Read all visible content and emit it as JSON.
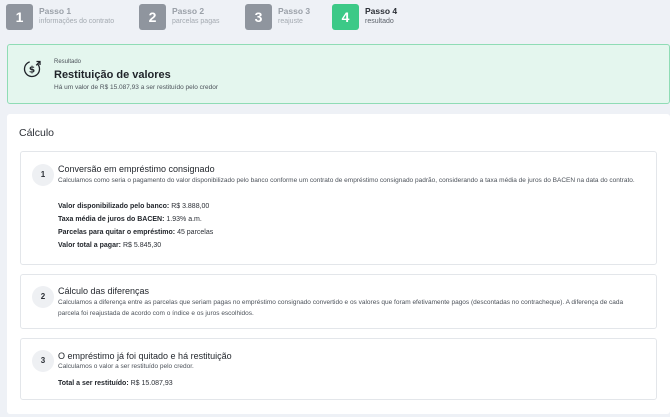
{
  "stepper": {
    "steps": [
      {
        "number": "1",
        "title": "Passo 1",
        "subtitle": "informações do contrato"
      },
      {
        "number": "2",
        "title": "Passo 2",
        "subtitle": "parcelas pagas"
      },
      {
        "number": "3",
        "title": "Passo 3",
        "subtitle": "reajuste"
      },
      {
        "number": "4",
        "title": "Passo 4",
        "subtitle": "resultado"
      }
    ],
    "active_step": 4
  },
  "result": {
    "label": "Resultado",
    "title": "Restituição de valores",
    "message": "Há um valor de R$ 15.087,93 a ser restituído pelo credor",
    "icon": "dollar-refund-icon"
  },
  "calculation": {
    "title": "Cálculo",
    "cards": [
      {
        "number": "1",
        "title": "Conversão em empréstimo consignado",
        "text": "Calculamos como seria o pagamento do valor disponibilizado pelo banco conforme um contrato de empréstimo consignado padrão, considerando a taxa média de juros do BACEN na data do contrato.",
        "rows": [
          {
            "label": "Valor disponibilizado pelo banco:",
            "value": "R$ 3.888,00"
          },
          {
            "label": "Taxa média de juros do BACEN:",
            "value": "1.93% a.m."
          },
          {
            "label": "Parcelas para quitar o empréstimo:",
            "value": "45 parcelas"
          },
          {
            "label": "Valor total a pagar:",
            "value": "R$ 5.845,30"
          }
        ]
      },
      {
        "number": "2",
        "title": "Cálculo das diferenças",
        "text": "Calculamos a diferença entre as parcelas que seriam pagas no empréstimo consignado convertido e os valores que foram efetivamente pagos (descontadas no contracheque). A diferença de cada parcela foi reajustada de acordo com o índice e os juros escolhidos."
      },
      {
        "number": "3",
        "title": "O empréstimo já foi quitado e há restituição",
        "text": "Calculamos o valor a ser restituído pelo credor.",
        "rows": [
          {
            "label": "Total a ser restituído:",
            "value": "R$ 15.087,93"
          }
        ]
      }
    ]
  },
  "colors": {
    "active_step": "#3cc987",
    "inactive_step": "#8f959e",
    "result_bg": "#e4f6ee",
    "result_border": "#8fdcb5",
    "page_bg": "#eef1f6"
  }
}
